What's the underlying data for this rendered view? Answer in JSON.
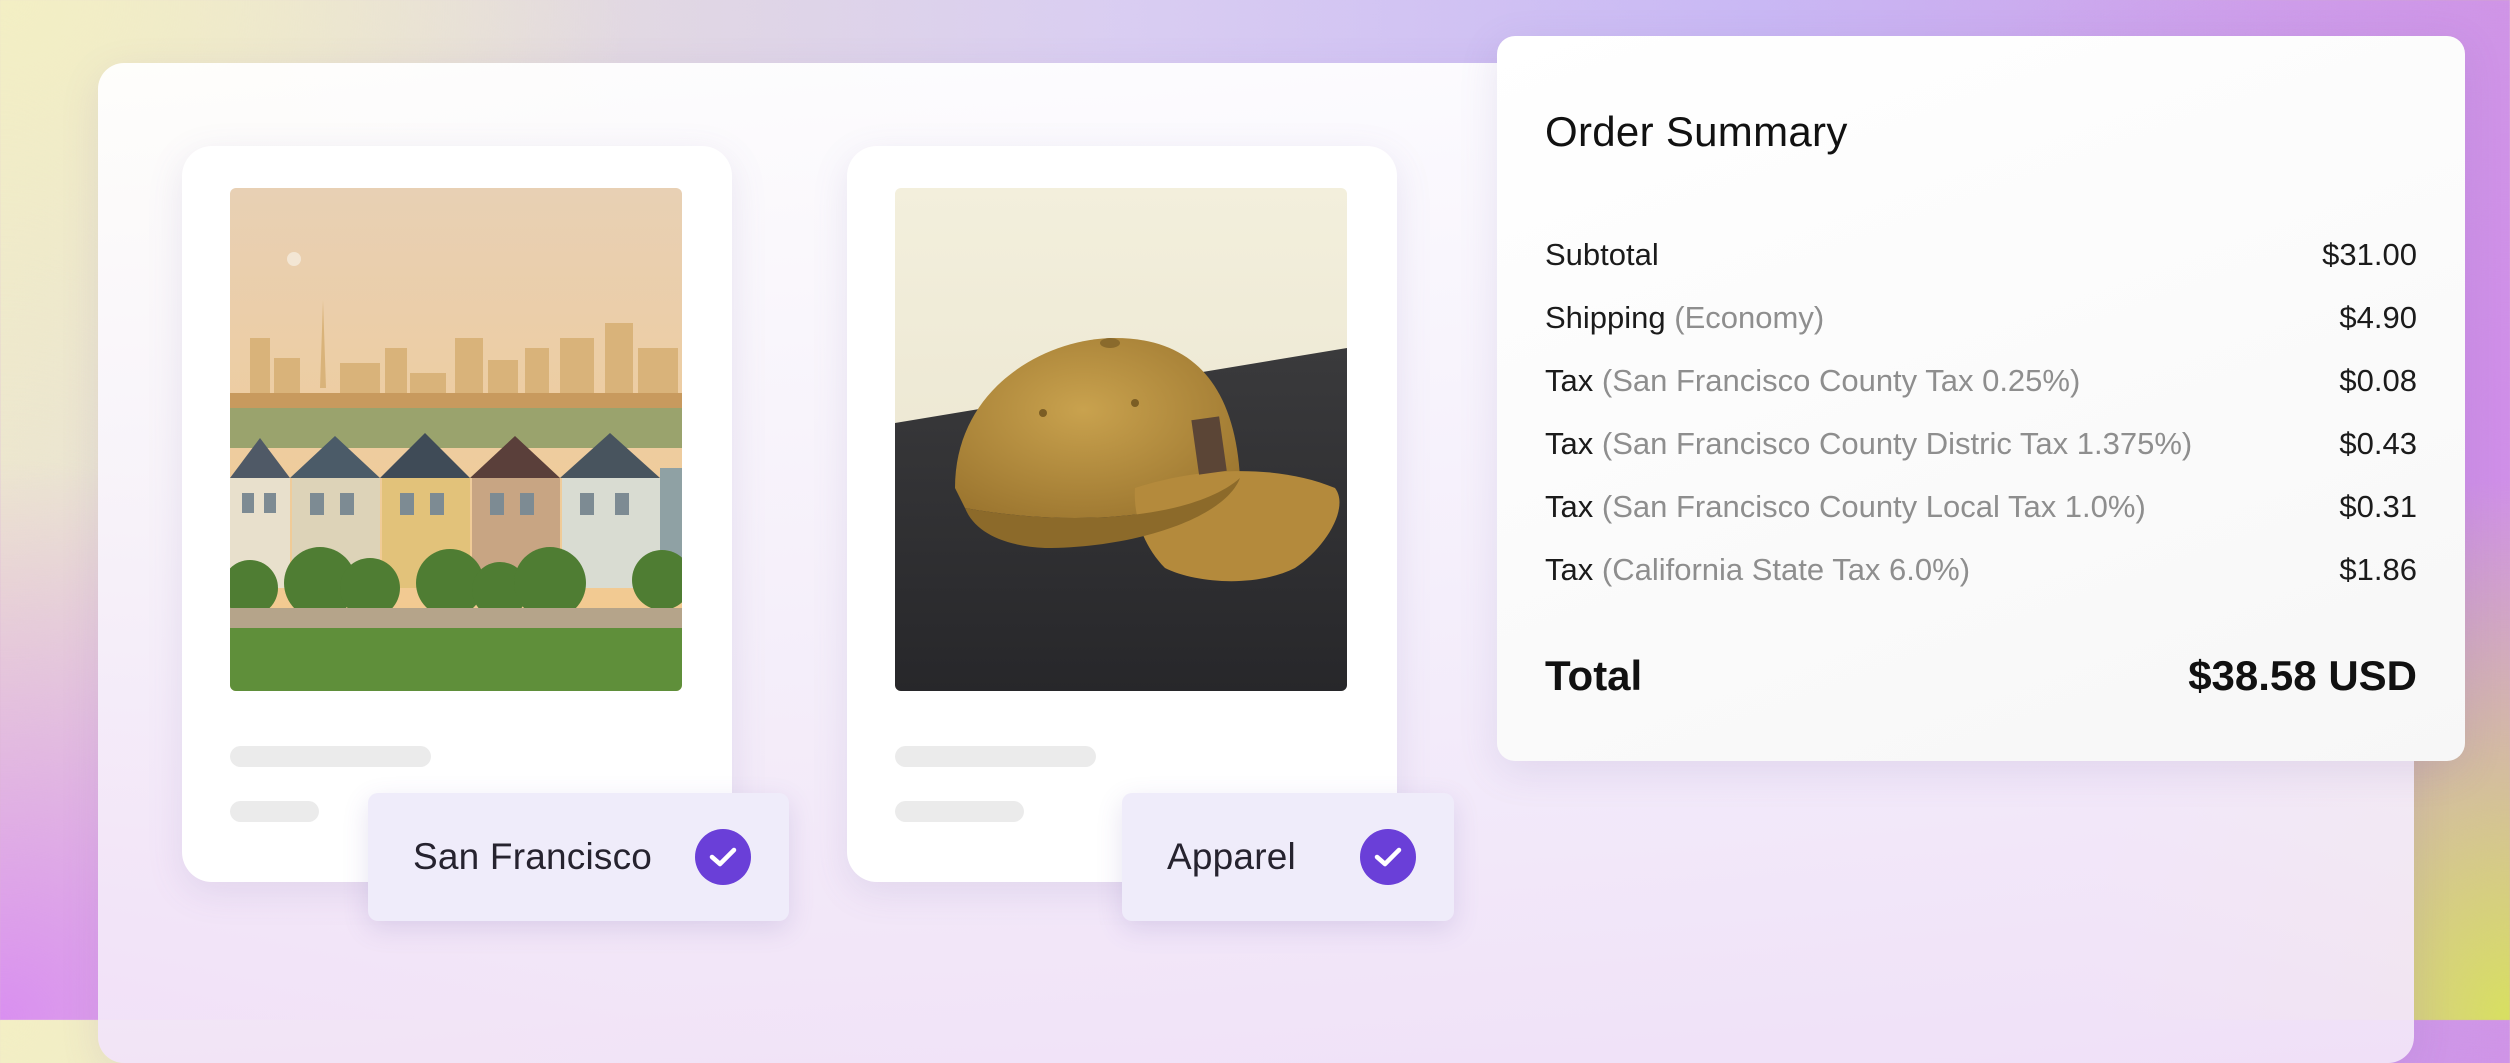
{
  "products": [
    {
      "name": "San Francisco",
      "image": "painted-ladies-photo",
      "selected": true
    },
    {
      "name": "Apparel",
      "image": "cap-photo",
      "selected": true
    }
  ],
  "summary": {
    "title": "Order Summary",
    "rows": [
      {
        "label": "Subtotal",
        "note": "",
        "amount": "$31.00"
      },
      {
        "label": "Shipping",
        "note": "(Economy)",
        "amount": "$4.90"
      },
      {
        "label": "Tax",
        "note": "(San Francisco County Tax 0.25%)",
        "amount": "$0.08"
      },
      {
        "label": "Tax",
        "note": "(San Francisco County Distric Tax 1.375%)",
        "amount": "$0.43"
      },
      {
        "label": "Tax",
        "note": "(San Francisco County Local Tax 1.0%)",
        "amount": "$0.31"
      },
      {
        "label": "Tax",
        "note": "(California State Tax 6.0%)",
        "amount": "$1.86"
      }
    ],
    "total_label": "Total",
    "total_amount": "$38.58 USD"
  },
  "colors": {
    "accent": "#6a3fd8",
    "chip_bg": "#efecfa",
    "note": "#8e8e8e"
  }
}
